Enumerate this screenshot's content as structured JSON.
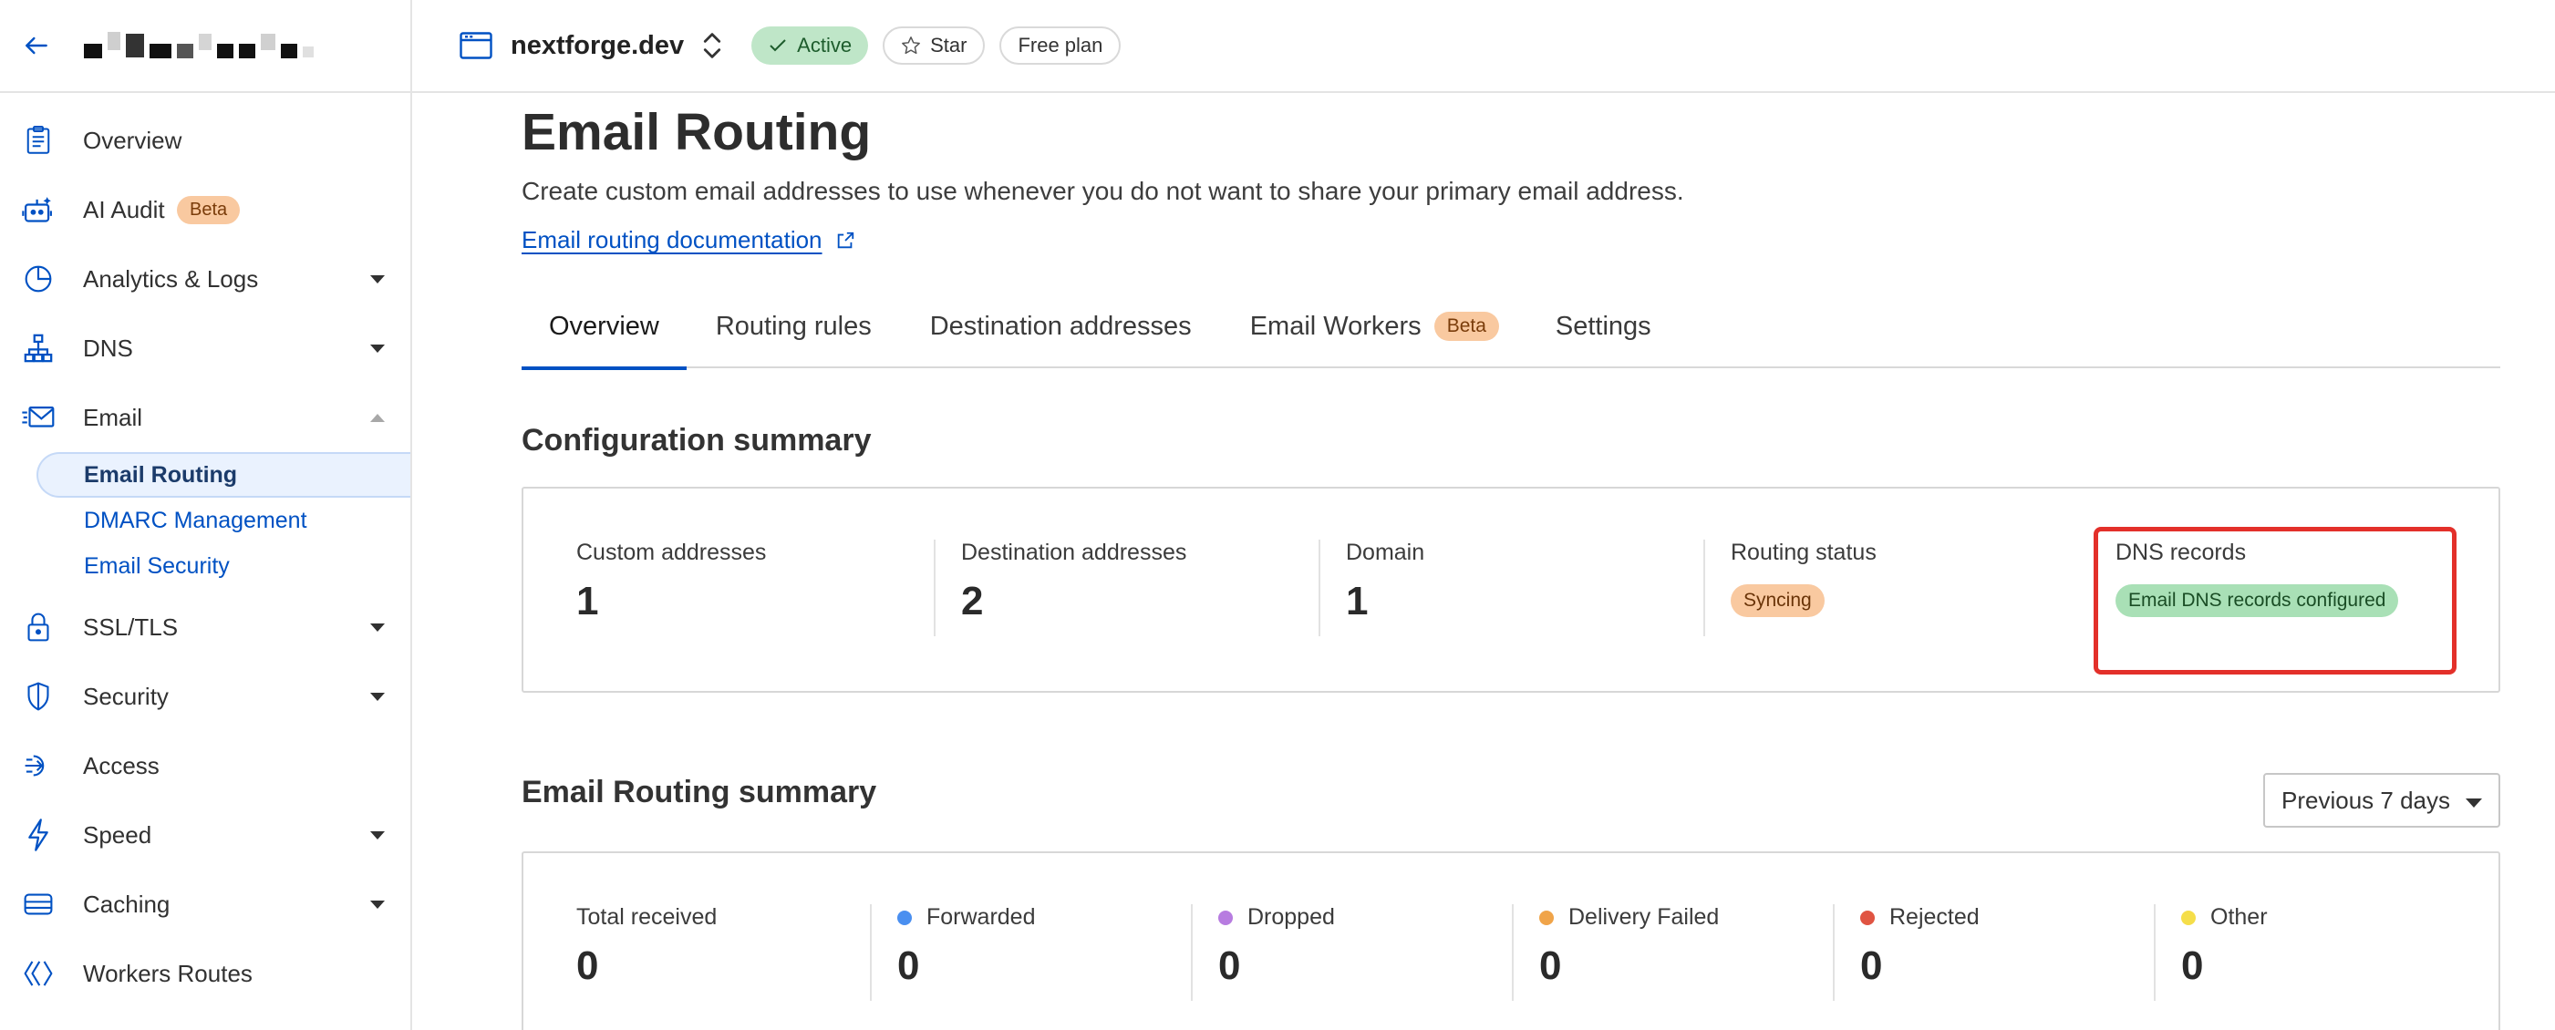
{
  "sidebar": {
    "items": [
      {
        "label": "Overview",
        "icon": "clipboard-icon"
      },
      {
        "label": "AI Audit",
        "icon": "robot-icon",
        "badge": "Beta"
      },
      {
        "label": "Analytics & Logs",
        "icon": "pie-chart-icon"
      },
      {
        "label": "DNS",
        "icon": "network-icon"
      },
      {
        "label": "Email",
        "icon": "email-icon"
      },
      {
        "label": "SSL/TLS",
        "icon": "lock-icon"
      },
      {
        "label": "Security",
        "icon": "shield-icon"
      },
      {
        "label": "Access",
        "icon": "access-icon"
      },
      {
        "label": "Speed",
        "icon": "lightning-icon"
      },
      {
        "label": "Caching",
        "icon": "storage-icon"
      },
      {
        "label": "Workers Routes",
        "icon": "workers-icon"
      }
    ],
    "email_subitems": [
      "Email Routing",
      "DMARC Management",
      "Email Security"
    ]
  },
  "topbar": {
    "site_name": "nextforge.dev",
    "status": "Active",
    "star_label": "Star",
    "plan_label": "Free plan"
  },
  "page": {
    "title": "Email Routing",
    "description": "Create custom email addresses to use whenever you do not want to share your primary email address.",
    "doc_link": "Email routing documentation"
  },
  "tabs": [
    {
      "label": "Overview"
    },
    {
      "label": "Routing rules"
    },
    {
      "label": "Destination addresses"
    },
    {
      "label": "Email Workers",
      "badge": "Beta"
    },
    {
      "label": "Settings"
    }
  ],
  "config_summary": {
    "heading": "Configuration summary",
    "custom_addresses": {
      "label": "Custom addresses",
      "value": "1"
    },
    "destination_addresses": {
      "label": "Destination addresses",
      "value": "2"
    },
    "domain": {
      "label": "Domain",
      "value": "1"
    },
    "routing_status": {
      "label": "Routing status",
      "value": "Syncing"
    },
    "dns_records": {
      "label": "DNS records",
      "value": "Email DNS records configured"
    }
  },
  "routing_summary": {
    "heading": "Email Routing summary",
    "period": "Previous 7 days",
    "stats": [
      {
        "label": "Total received",
        "value": "0"
      },
      {
        "label": "Forwarded",
        "value": "0",
        "color": "#4a8ff0"
      },
      {
        "label": "Dropped",
        "value": "0",
        "color": "#b77ce0"
      },
      {
        "label": "Delivery Failed",
        "value": "0",
        "color": "#f0a449"
      },
      {
        "label": "Rejected",
        "value": "0",
        "color": "#e05442"
      },
      {
        "label": "Other",
        "value": "0",
        "color": "#f5de4a"
      }
    ]
  },
  "colors": {
    "accent": "#0051c3",
    "highlight": "#e3302a"
  }
}
